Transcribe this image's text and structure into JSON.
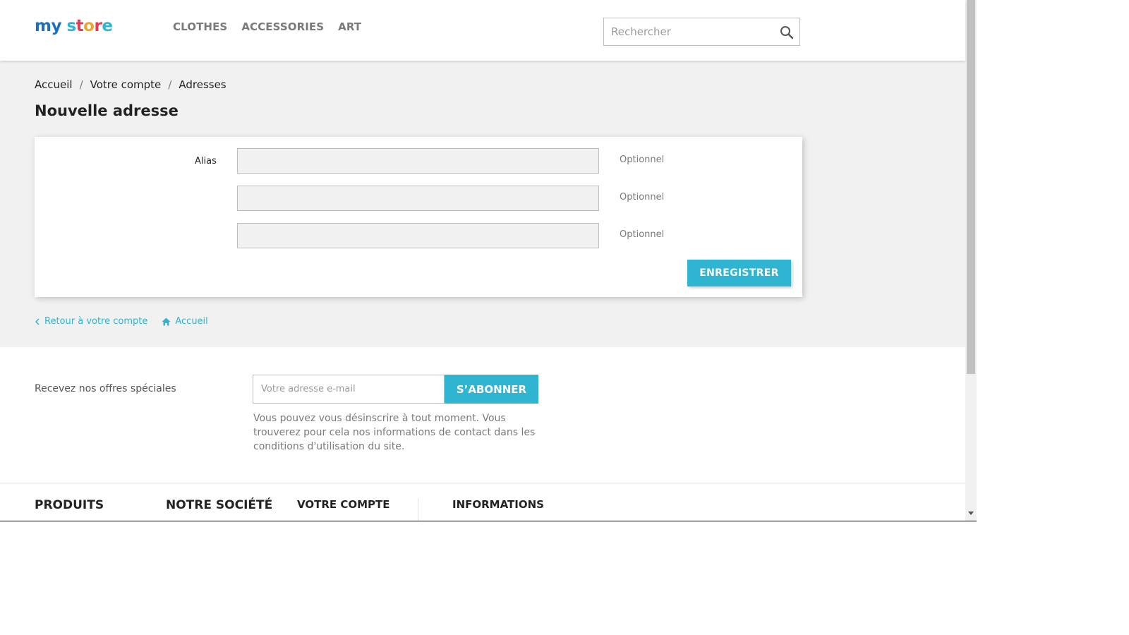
{
  "header": {
    "logo": [
      "my ",
      "s",
      "t",
      "o",
      "r",
      "e"
    ],
    "nav": [
      "CLOTHES",
      "ACCESSORIES",
      "ART"
    ],
    "search_placeholder": "Rechercher"
  },
  "breadcrumb": [
    "Accueil",
    "Votre compte",
    "Adresses"
  ],
  "page_title": "Nouvelle adresse",
  "form": {
    "alias_label": "Alias",
    "optional_label": "Optionnel",
    "save_label": "ENREGISTRER"
  },
  "links": {
    "back": "Retour à votre compte",
    "home": "Accueil"
  },
  "newsletter": {
    "label": "Recevez nos offres spéciales",
    "placeholder": "Votre adresse e-mail",
    "button": "S’ABONNER",
    "note": "Vous pouvez vous désinscrire à tout moment. Vous trouverez pour cela nos informations de contact dans les conditions d'utilisation du site."
  },
  "footer": {
    "col1": "PRODUITS",
    "col2": "NOTRE SOCIÉTÉ",
    "col3": "VOTRE COMPTE",
    "col4": "INFORMATIONS"
  },
  "colors": {
    "accent": "#2fb5d2",
    "background_grey": "#f1f1f1"
  }
}
